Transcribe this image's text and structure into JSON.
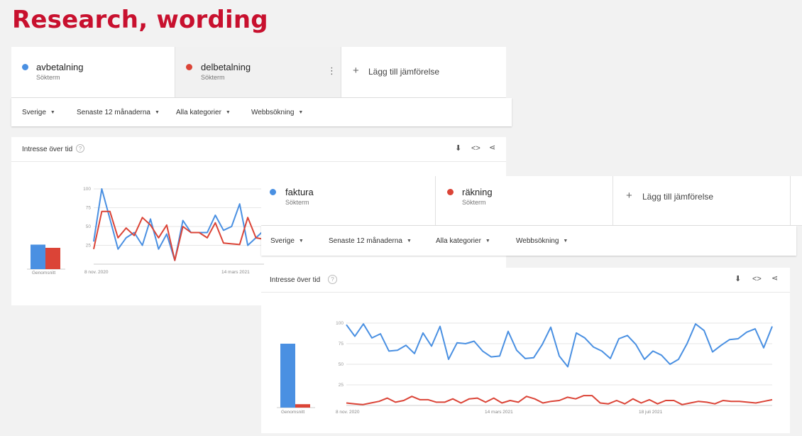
{
  "slide_title": "Research, wording",
  "colors": {
    "blue": "#4a90e2",
    "red": "#db4437",
    "title": "#c8102e"
  },
  "panel1": {
    "terms": [
      {
        "name": "avbetalning",
        "sub": "Sökterm",
        "color": "#4a90e2"
      },
      {
        "name": "delbetalning",
        "sub": "Sökterm",
        "color": "#db4437"
      }
    ],
    "add_compare": "Lägg till jämförelse",
    "filters": [
      "Sverige",
      "Senaste 12 månaderna",
      "Alla kategorier",
      "Webbsökning"
    ],
    "card_title": "Intresse över tid",
    "average_label": "Genomsnitt",
    "x_ticks": [
      "8 nov. 2020",
      "14 mars 2021"
    ]
  },
  "panel2": {
    "terms": [
      {
        "name": "faktura",
        "sub": "Sökterm",
        "color": "#4a90e2"
      },
      {
        "name": "räkning",
        "sub": "Sökterm",
        "color": "#db4437"
      }
    ],
    "add_compare": "Lägg till jämförelse",
    "filters": [
      "Sverige",
      "Senaste 12 månaderna",
      "Alla kategorier",
      "Webbsökning"
    ],
    "card_title": "Intresse över tid",
    "average_label": "Genomsnitt",
    "x_ticks": [
      "8 nov. 2020",
      "14 mars 2021",
      "18 juli 2021"
    ]
  },
  "chart_data": [
    {
      "type": "line",
      "x_ticks": [
        "8 nov. 2020",
        "14 mars 2021"
      ],
      "ylim": [
        0,
        100
      ],
      "y_ticks": [
        25,
        50,
        75,
        100
      ],
      "grid": true,
      "average": {
        "label": "Genomsnitt",
        "values": [
          46,
          40
        ]
      },
      "series": [
        {
          "name": "avbetalning",
          "color": "#4a90e2",
          "values": [
            30,
            100,
            60,
            20,
            35,
            42,
            25,
            60,
            20,
            40,
            5,
            58,
            42,
            42,
            42,
            65,
            45,
            50,
            80,
            25,
            35,
            45
          ]
        },
        {
          "name": "delbetalning",
          "color": "#db4437",
          "values": [
            20,
            70,
            70,
            35,
            48,
            38,
            62,
            52,
            35,
            52,
            5,
            50,
            42,
            42,
            35,
            55,
            28,
            27,
            26,
            62,
            35,
            33
          ]
        }
      ]
    },
    {
      "type": "line",
      "x_ticks": [
        "8 nov. 2020",
        "14 mars 2021",
        "18 juli 2021"
      ],
      "ylim": [
        0,
        100
      ],
      "y_ticks": [
        25,
        50,
        75,
        100
      ],
      "grid": true,
      "average": {
        "label": "Genomsnitt",
        "values": [
          75,
          4
        ]
      },
      "series": [
        {
          "name": "faktura",
          "color": "#4a90e2",
          "values": [
            98,
            84,
            99,
            82,
            87,
            66,
            67,
            73,
            63,
            88,
            72,
            96,
            56,
            76,
            75,
            78,
            66,
            59,
            60,
            90,
            67,
            57,
            58,
            74,
            95,
            60,
            47,
            88,
            82,
            71,
            66,
            57,
            81,
            85,
            74,
            56,
            66,
            61,
            50,
            56,
            75,
            99,
            91,
            65,
            73,
            80,
            81,
            89,
            93,
            70,
            96
          ]
        },
        {
          "name": "räkning",
          "color": "#db4437",
          "values": [
            3,
            2,
            1,
            3,
            5,
            9,
            4,
            6,
            11,
            7,
            7,
            4,
            4,
            8,
            3,
            8,
            9,
            4,
            9,
            3,
            6,
            4,
            11,
            8,
            3,
            5,
            6,
            10,
            8,
            12,
            12,
            3,
            2,
            6,
            2,
            8,
            3,
            7,
            2,
            6,
            6,
            1,
            3,
            5,
            4,
            2,
            6,
            5,
            5,
            4,
            3,
            5,
            7
          ]
        }
      ]
    }
  ]
}
